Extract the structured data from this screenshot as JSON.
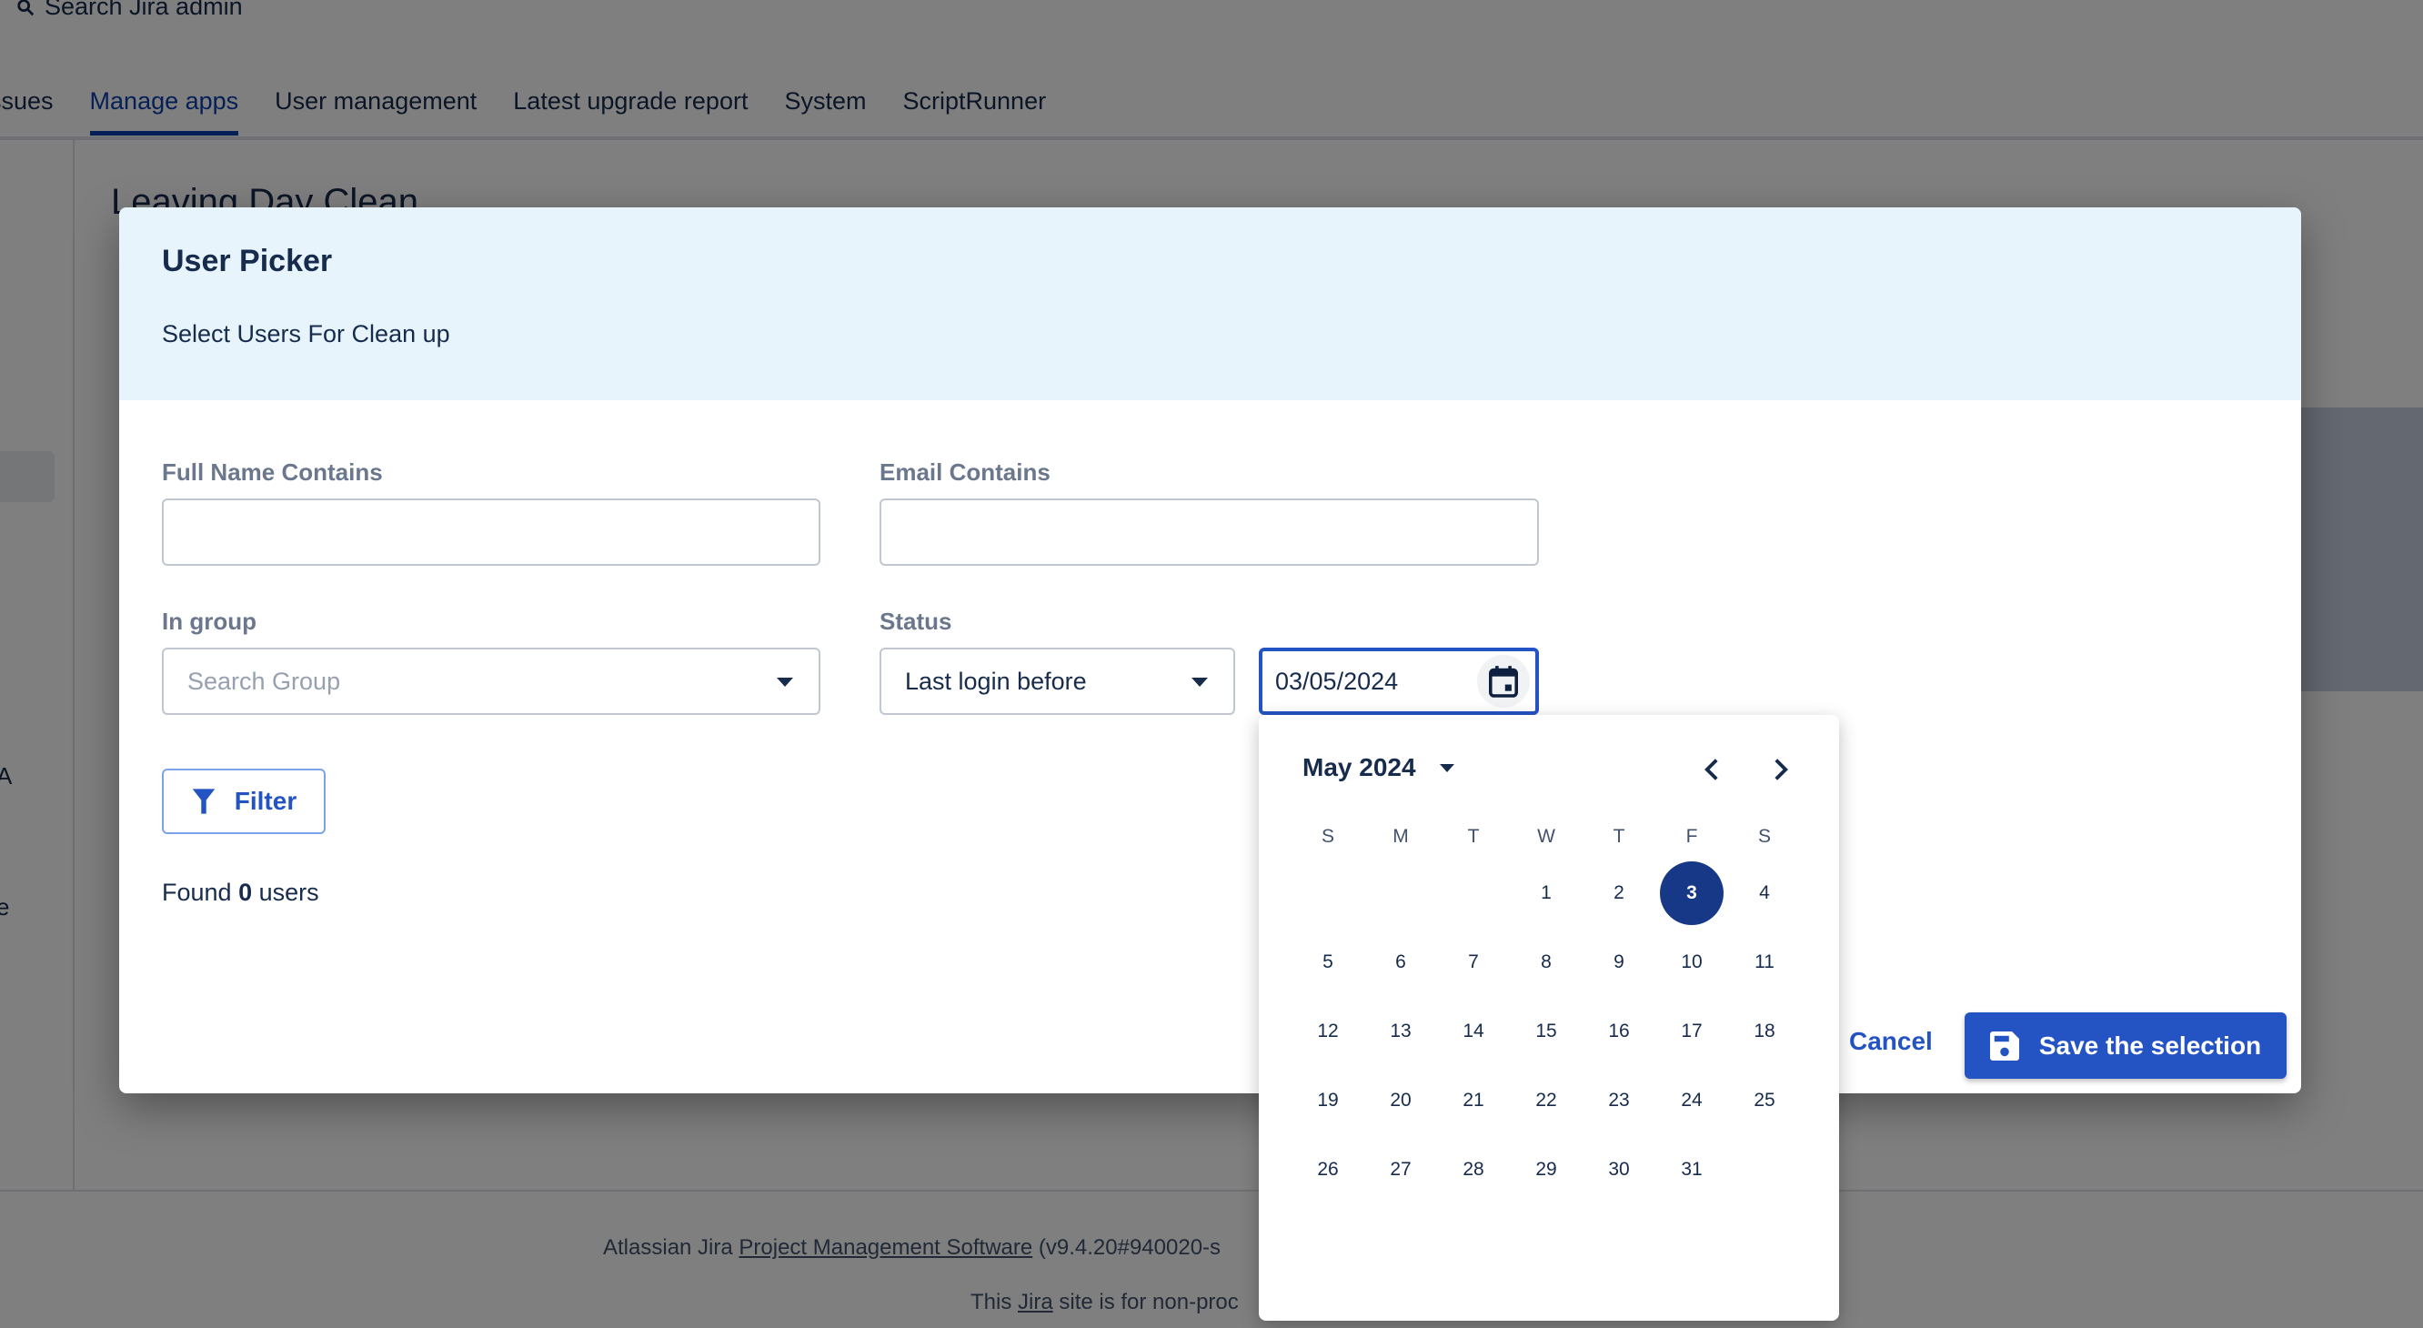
{
  "background": {
    "search_label": "Search Jira admin",
    "tabs": [
      {
        "label": "Issues",
        "visible_text": "ssues",
        "active": false
      },
      {
        "label": "Manage apps",
        "active": true
      },
      {
        "label": "User management",
        "active": false
      },
      {
        "label": "Latest upgrade report",
        "active": false
      },
      {
        "label": "System",
        "active": false
      },
      {
        "label": "ScriptRunner",
        "active": false
      }
    ],
    "page_title": "Leaving Day Clean",
    "sidebar_fragments": [
      "A",
      "e"
    ],
    "footer": {
      "line1_prefix": "Atlassian Jira ",
      "line1_link": "Project Management Software",
      "line1_suffix": " (v9.4.20#940020-s",
      "line2_prefix": "This ",
      "line2_link": "Jira",
      "line2_suffix": " site is for non-proc"
    }
  },
  "dialog": {
    "title": "User Picker",
    "subtitle": "Select Users For Clean up",
    "fields": {
      "full_name": {
        "label": "Full Name Contains",
        "value": "",
        "placeholder": ""
      },
      "email": {
        "label": "Email Contains",
        "value": "",
        "placeholder": ""
      },
      "group": {
        "label": "In group",
        "placeholder": "Search Group"
      },
      "status": {
        "label": "Status",
        "selected": "Last login before"
      },
      "date": {
        "value": "03/05/2024"
      }
    },
    "filter_label": "Filter",
    "found": {
      "prefix": "Found ",
      "count": "0",
      "suffix": " users"
    },
    "cancel_label": "Cancel",
    "save_label": "Save the selection"
  },
  "calendar": {
    "month_label": "May 2024",
    "weekdays": [
      "S",
      "M",
      "T",
      "W",
      "T",
      "F",
      "S"
    ],
    "leading_blanks": 3,
    "days_in_month": 31,
    "selected_day": 3
  },
  "colors": {
    "accent": "#2453c4",
    "selected_day": "#173887",
    "header_band": "#e8f4fc"
  }
}
